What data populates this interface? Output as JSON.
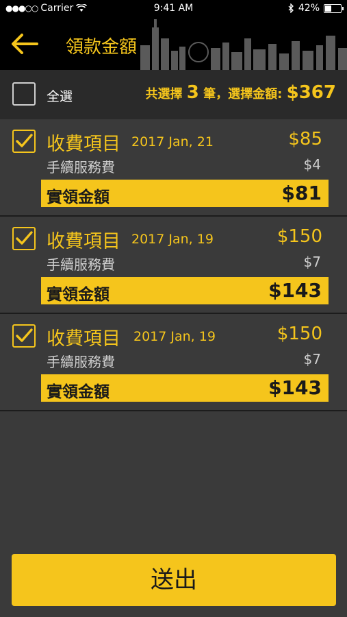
{
  "status_bar": {
    "carrier": "Carrier",
    "time": "9:41 AM",
    "battery_text": "42%",
    "battery_level": 0.42
  },
  "nav": {
    "title": "領款金額"
  },
  "select_all": {
    "label": "全選",
    "summary_prefix": "共選擇",
    "summary_count": "3",
    "summary_middle": "筆，選擇金額:",
    "summary_total": "$367"
  },
  "items": [
    {
      "title": "收費項目",
      "date": "2017 Jan, 21",
      "amount": "$85",
      "fee_label": "手續服務費",
      "fee": "$4",
      "net_label": "實領金額",
      "net": "$81"
    },
    {
      "title": "收費項目",
      "date": "2017 Jan, 19",
      "amount": "$150",
      "fee_label": "手續服務費",
      "fee": "$7",
      "net_label": "實領金額",
      "net": "$143"
    },
    {
      "title": "收費項目",
      "date": "2017 Jan, 19",
      "amount": "$150",
      "fee_label": "手續服務費",
      "fee": "$7",
      "net_label": "實領金額",
      "net": "$143"
    }
  ],
  "submit": {
    "label": "送出"
  },
  "colors": {
    "accent": "#f5c51c",
    "background": "#3a3a3a",
    "bar": "#2a2a2a"
  }
}
